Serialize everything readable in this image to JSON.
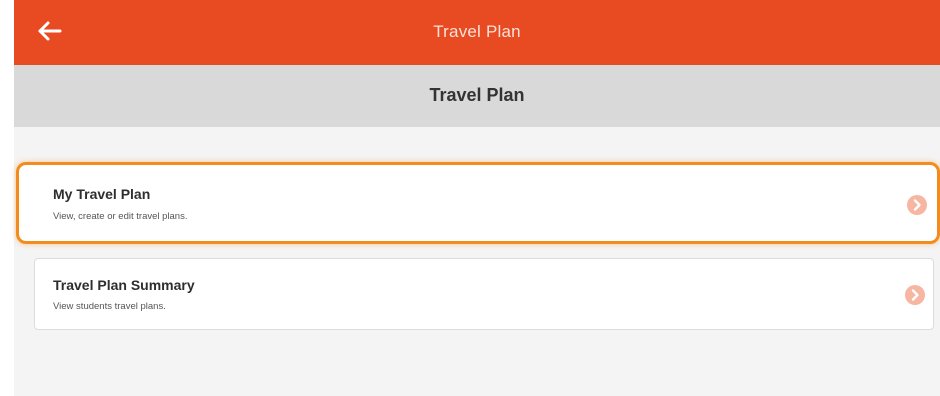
{
  "colors": {
    "topbar_bg": "#e84a22",
    "subheader_bg": "#d9d9d9",
    "highlight_border": "#f28c1c",
    "chevron_bg": "#f6b6a2"
  },
  "header": {
    "back_icon": "arrow-left-icon",
    "title": "Travel Plan"
  },
  "subheader": {
    "title": "Travel Plan"
  },
  "menu": {
    "items": [
      {
        "title": "My Travel Plan",
        "description": "View, create or edit travel plans.",
        "icon": "chevron-right-circle-icon",
        "highlighted": true
      },
      {
        "title": "Travel Plan Summary",
        "description": "View students travel plans.",
        "icon": "chevron-right-circle-icon",
        "highlighted": false
      }
    ]
  }
}
